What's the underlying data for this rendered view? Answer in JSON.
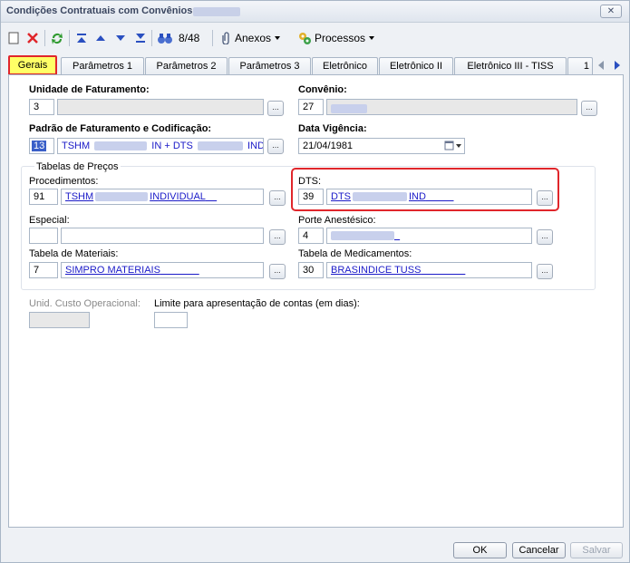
{
  "window": {
    "title": "Condições Contratuais com Convênios:"
  },
  "toolbar": {
    "record_counter": "8/48",
    "anexos_label": "Anexos",
    "processos_label": "Processos"
  },
  "tabs": [
    {
      "label": "Gerais"
    },
    {
      "label": "Parâmetros 1"
    },
    {
      "label": "Parâmetros 2"
    },
    {
      "label": "Parâmetros 3"
    },
    {
      "label": "Eletrônico"
    },
    {
      "label": "Eletrônico II"
    },
    {
      "label": "Eletrônico III - TISS"
    },
    {
      "label": "1"
    }
  ],
  "form": {
    "unidade_label": "Unidade de Faturamento:",
    "unidade_code": "3",
    "convenio_label": "Convênio:",
    "convenio_code": "27",
    "padrao_label": "Padrão de Faturamento e Codificação:",
    "padrao_code": "13",
    "padrao_part1": "TSHM",
    "padrao_part2": "IN + DTS",
    "padrao_part3": "IND",
    "vigencia_label": "Data Vigência:",
    "vigencia_value": "21/04/1981",
    "tabelas_legend": "Tabelas de Preços",
    "proc_label": "Procedimentos:",
    "proc_code": "91",
    "proc_name_a": "TSHM",
    "proc_name_b": "INDIVIDUAL",
    "dts_label": "DTS:",
    "dts_code": "39",
    "dts_name_a": "DTS",
    "dts_name_b": "IND",
    "especial_label": "Especial:",
    "porte_label": "Porte Anestésico:",
    "porte_code": "4",
    "mat_label": "Tabela de Materiais:",
    "mat_code": "7",
    "mat_name": "SIMPRO MATERIAIS",
    "med_label": "Tabela de Medicamentos:",
    "med_code": "30",
    "med_name": "BRASINDICE TUSS",
    "custo_label": "Unid. Custo Operacional:",
    "limite_label": "Limite para apresentação de contas (em dias):"
  },
  "buttons": {
    "ok": "OK",
    "cancel": "Cancelar",
    "save": "Salvar"
  },
  "colors": {
    "tab_highlight": "#ffff66",
    "annotation_red": "#e0262b",
    "link_blue": "#1a1ac8"
  }
}
